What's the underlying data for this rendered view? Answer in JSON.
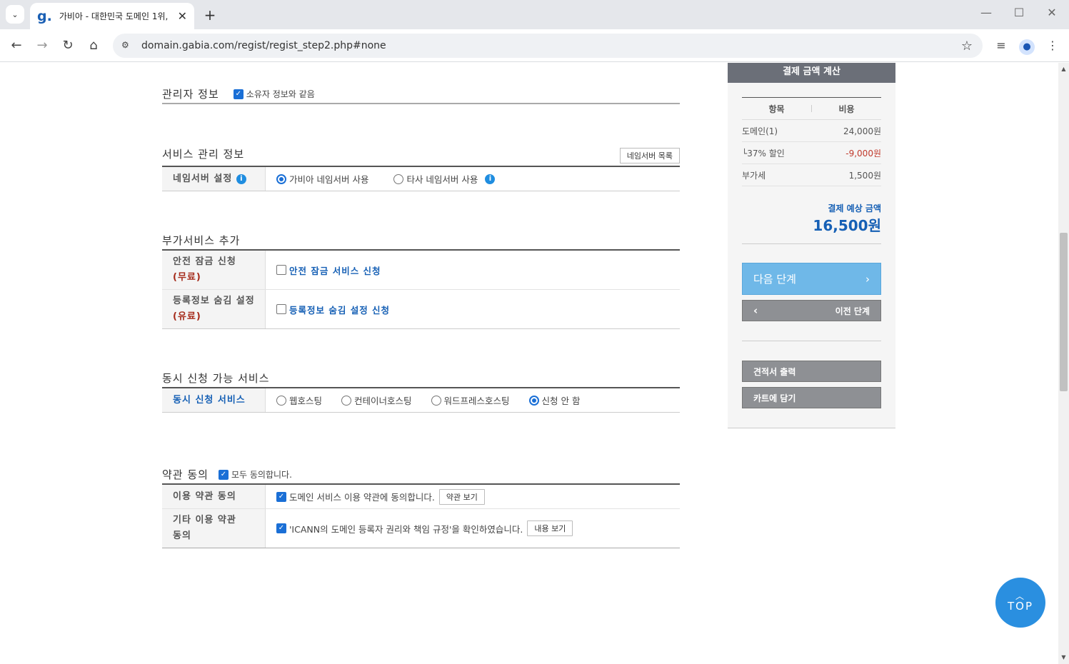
{
  "browser": {
    "tab_favicon": "g.",
    "tab_title": "가비아 - 대한민국 도메인 1위,",
    "tab_close": "✕",
    "new_tab": "+",
    "url": "domain.gabia.com/regist/regist_step2.php#none"
  },
  "admin": {
    "title": "관리자 정보",
    "same_as_owner": "소유자 정보와 같음"
  },
  "service": {
    "title": "서비스 관리 정보",
    "ns_list_button": "네임서버 목록",
    "ns_label": "네임서버 설정",
    "opt_gabia": "가비아 네임서버 사용",
    "opt_other": "타사 네임서버 사용"
  },
  "addon": {
    "title": "부가서비스 추가",
    "lock_label": "안전 잠금 신청",
    "lock_price": "(무료)",
    "lock_option": "안전 잠금 서비스 신청",
    "hide_label": "등록정보 숨김 설정",
    "hide_price": "(유료)",
    "hide_option": "등록정보 숨김 설정 신청"
  },
  "simul": {
    "title": "동시 신청 가능 서비스",
    "label": "동시 신청 서비스",
    "options": [
      "웹호스팅",
      "컨테이너호스팅",
      "워드프레스호스팅",
      "신청 안 함"
    ],
    "selected_index": 3
  },
  "terms": {
    "title": "약관 동의",
    "agree_all": "모두 동의합니다.",
    "row1_label": "이용 약관 동의",
    "row1_text": "도메인 서비스 이용 약관에 동의합니다.",
    "row1_button": "약관 보기",
    "row2_label_1": "기타 이용 약관",
    "row2_label_2": "동의",
    "row2_text": "'ICANN의 도메인 등록자 권리와 책임 규정'을 확인하였습니다.",
    "row2_button": "내용 보기"
  },
  "side": {
    "title": "결제 금액 계산",
    "col_item": "항목",
    "col_cost": "비용",
    "rows": [
      {
        "item": "도메인(1)",
        "cost": "24,000원"
      },
      {
        "item": "└37% 할인",
        "cost": "-9,000원"
      },
      {
        "item": "부가세",
        "cost": "1,500원"
      }
    ],
    "total_label": "결제 예상 금액",
    "total_value": "16,500원",
    "next_button": "다음 단계",
    "prev_button": "이전 단계",
    "quote_button": "견적서 출력",
    "cart_button": "카트에 담기"
  },
  "top_button": "TOP",
  "colors": {
    "accent_blue": "#1660b5",
    "button_blue": "#6fb8e8",
    "top_blue": "#2a8fe0",
    "discount_red": "#c0392b"
  }
}
